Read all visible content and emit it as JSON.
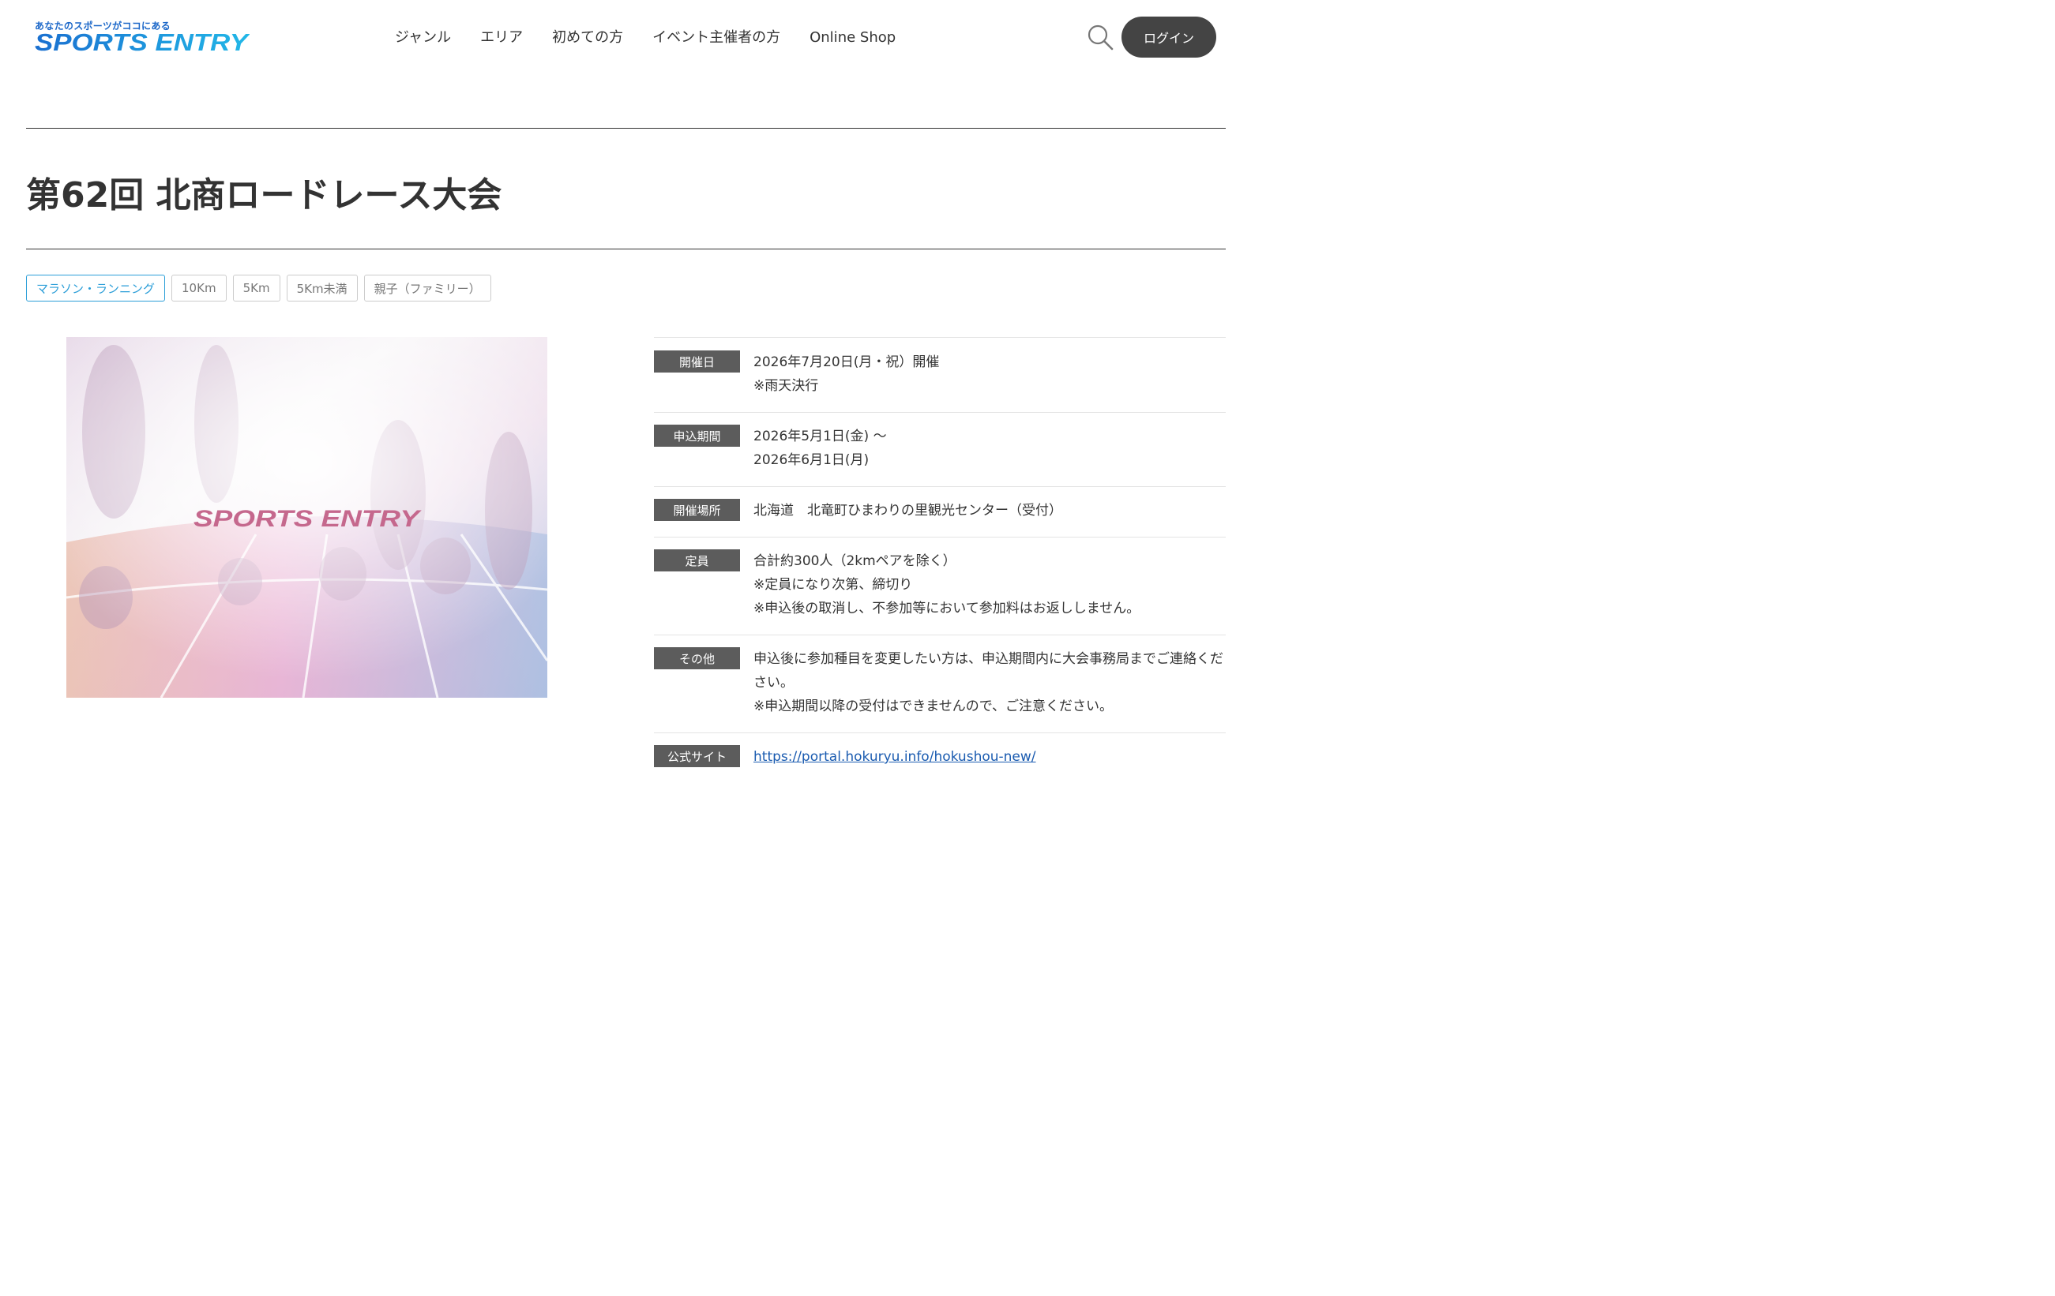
{
  "logo": {
    "tagline": "あなたのスポーツがココにある",
    "text": "SPORTS ENTRY"
  },
  "nav": [
    {
      "label": "ジャンル"
    },
    {
      "label": "エリア"
    },
    {
      "label": "初めての方"
    },
    {
      "label": "イベント主催者の方"
    },
    {
      "label": "Online Shop"
    }
  ],
  "header": {
    "search_icon": "search-icon",
    "login_label": "ログイン"
  },
  "event": {
    "title": "第62回 北商ロードレース大会",
    "tags": [
      "マラソン・ランニング",
      "10Km",
      "5Km",
      "5Km未満",
      "親子（ファミリー）"
    ],
    "image_logo_text": "SPORTS ENTRY",
    "info": [
      {
        "label": "開催日",
        "values": [
          "2026年7月20日(月・祝）開催",
          "※雨天決行"
        ]
      },
      {
        "label": "申込期間",
        "values": [
          "2026年5月1日(金) 〜",
          "2026年6月1日(月)"
        ]
      },
      {
        "label": "開催場所",
        "values": [
          "北海道　北竜町ひまわりの里観光センター（受付）"
        ]
      },
      {
        "label": "定員",
        "values": [
          "合計約300人（2kmペアを除く）",
          "※定員になり次第、締切り",
          "※申込後の取消し、不参加等において参加料はお返ししません。"
        ]
      },
      {
        "label": "その他",
        "values": [
          "申込後に参加種目を変更したい方は、申込期間内に大会事務局までご連絡ください。",
          "※申込期間以降の受付はできませんので、ご注意ください。"
        ]
      },
      {
        "label": "公式サイト",
        "link": "https://portal.hokuryu.info/hokushou-new/"
      }
    ]
  },
  "colors": {
    "logo_blue": "#1a9be0",
    "accent_tag": "#2b9ed8",
    "label_bg": "#5c5c5c",
    "login_bg": "#444444",
    "link": "#1a5bb0"
  }
}
